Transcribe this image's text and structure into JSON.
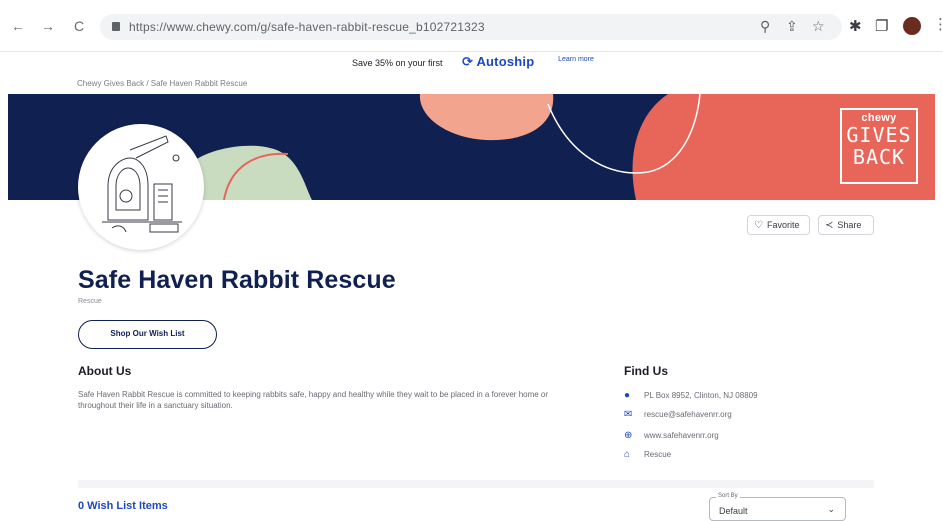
{
  "browser": {
    "url": "https://www.chewy.com/g/safe-haven-rabbit-rescue_b102721323",
    "back_icon": "←",
    "forward_icon": "→",
    "reload_icon": "C",
    "zoom_icon": "⚲",
    "share_icon": "⇪",
    "star_icon": "☆",
    "extensions_icon": "✱",
    "sidepanel_icon": "❐",
    "menu_icon": "⋮"
  },
  "promo": {
    "text": "Save 35% on your first",
    "autoship": "Autoship",
    "autoship_symbol": "⟳",
    "learn_more": "Learn more"
  },
  "breadcrumb": "Chewy Gives Back / Safe Haven Rabbit Rescue",
  "banner": {
    "chewy": "chewy",
    "gives": "GIVES",
    "back": "BACK",
    "colors": {
      "navy": "#102051",
      "coral": "#e8655a",
      "peach": "#f2a48f",
      "sage": "#c9dcc0"
    }
  },
  "actions": {
    "favorite": {
      "icon": "♡",
      "label": "Favorite"
    },
    "share": {
      "icon": "≺",
      "label": "Share"
    }
  },
  "org": {
    "name": "Safe Haven Rabbit Rescue",
    "sub": "Rescue",
    "wish_button": "Shop Our Wish List"
  },
  "about": {
    "heading": "About Us",
    "text": "Safe Haven Rabbit Rescue is committed to keeping rabbits safe, happy and healthy while they wait to be placed in a forever home or throughout their life in a sanctuary situation."
  },
  "find": {
    "heading": "Find Us",
    "address": "PL Box 8952, Clinton, NJ 08809",
    "email": "rescue@safehavenrr.org",
    "website": "www.safehavenrr.org",
    "type": "Rescue"
  },
  "wishlist": {
    "count_label": "0 Wish List Items",
    "sort_label": "Sort By",
    "sort_value": "Default"
  }
}
